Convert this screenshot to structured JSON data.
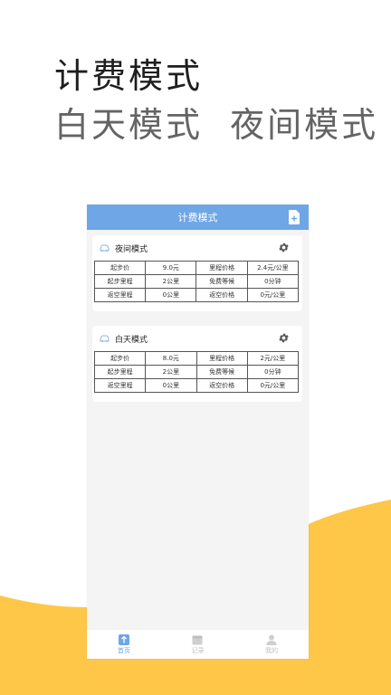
{
  "promo": {
    "title": "计费模式",
    "subtitle": "白天模式  夜间模式"
  },
  "colors": {
    "accent": "#6ea6e6",
    "wave": "#fec748",
    "app_bg": "#f4f4f4"
  },
  "app": {
    "header_title": "计费模式",
    "header_icon": "add-file-icon"
  },
  "modes": [
    {
      "name": "夜间模式",
      "rows": [
        [
          "起步价",
          "9.0元",
          "里程价格",
          "2.4元/公里"
        ],
        [
          "起步里程",
          "2公里",
          "免费等候",
          "0分钟"
        ],
        [
          "返空里程",
          "0公里",
          "返空价格",
          "0元/公里"
        ]
      ]
    },
    {
      "name": "白天模式",
      "rows": [
        [
          "起步价",
          "8.0元",
          "里程价格",
          "2元/公里"
        ],
        [
          "起步里程",
          "2公里",
          "免费等候",
          "0分钟"
        ],
        [
          "返空里程",
          "0公里",
          "返空价格",
          "0元/公里"
        ]
      ]
    }
  ],
  "tabs": [
    {
      "label": "首页",
      "icon": "home-icon",
      "active": true
    },
    {
      "label": "记录",
      "icon": "records-icon",
      "active": false
    },
    {
      "label": "我的",
      "icon": "profile-icon",
      "active": false
    }
  ]
}
